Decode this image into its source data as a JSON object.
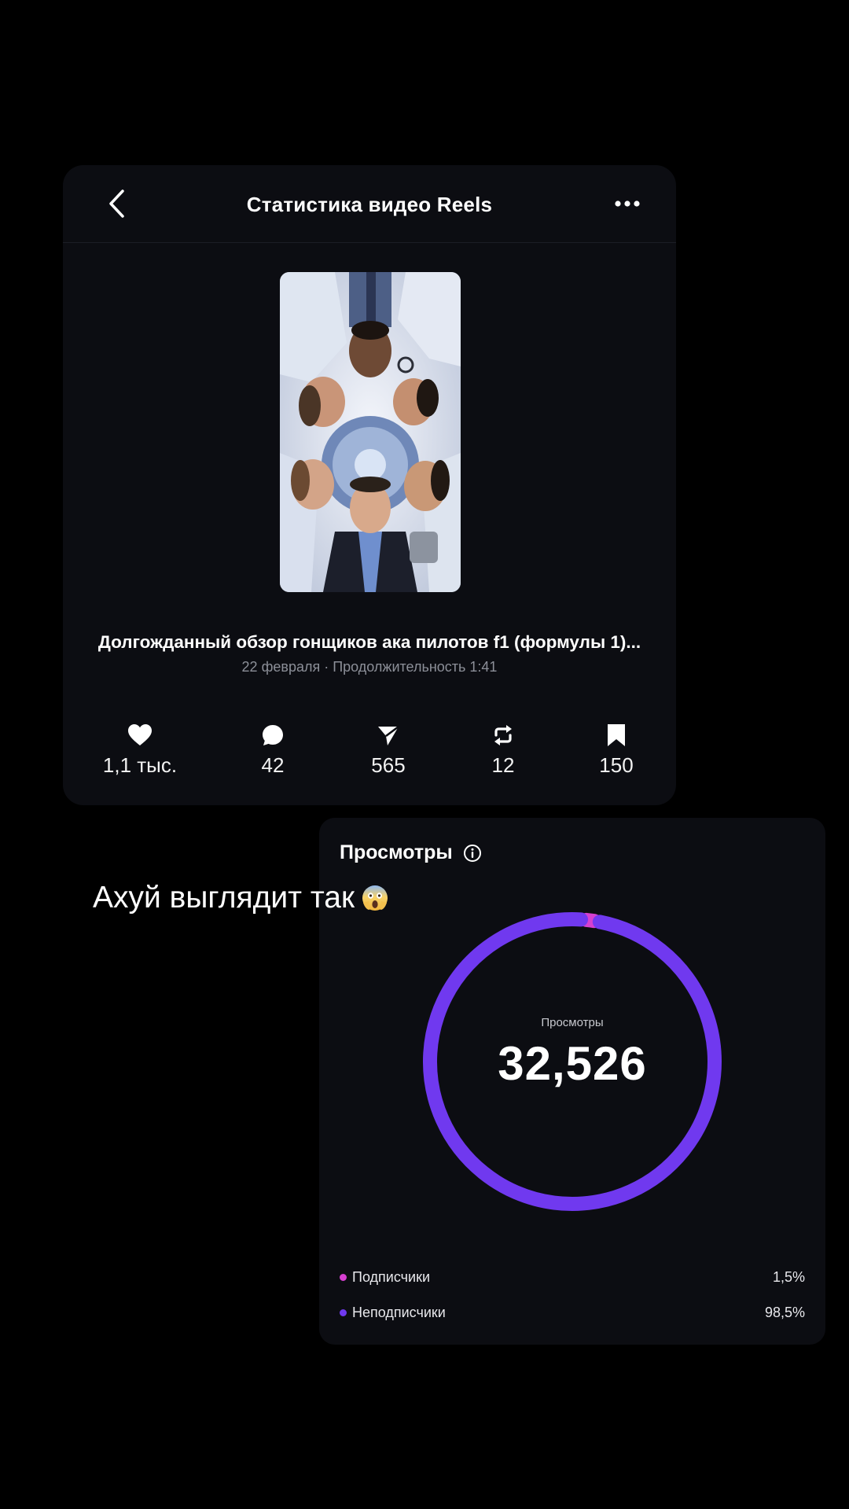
{
  "header": {
    "title": "Статистика видео Reels"
  },
  "video": {
    "title": "Долгожданный обзор гонщиков ака пилотов f1 (формулы 1)...",
    "meta": "22 февраля · Продолжительность 1:41"
  },
  "stats": [
    {
      "icon": "heart-icon",
      "value": "1,1 тыс."
    },
    {
      "icon": "comment-icon",
      "value": "42"
    },
    {
      "icon": "share-icon",
      "value": "565"
    },
    {
      "icon": "repost-icon",
      "value": "12"
    },
    {
      "icon": "bookmark-icon",
      "value": "150"
    }
  ],
  "caption": {
    "text": "Ахуй выглядит так",
    "emoji": "scream-emoji"
  },
  "views": {
    "title": "Просмотры",
    "center_label": "Просмотры",
    "total": "32,526",
    "legend": [
      {
        "name": "Подписчики",
        "percent": "1,5%",
        "color": "#d63fd0"
      },
      {
        "name": "Неподписчики",
        "percent": "98,5%",
        "color": "#7039ef"
      }
    ]
  },
  "chart_data": {
    "type": "pie",
    "categories": [
      "Подписчики",
      "Неподписчики"
    ],
    "values": [
      1.5,
      98.5
    ]
  },
  "colors": {
    "background": "#000000",
    "card": "#0c0d12",
    "accent_purple": "#7039ef",
    "accent_pink": "#d63fd0",
    "muted_text": "#8c8f98"
  }
}
